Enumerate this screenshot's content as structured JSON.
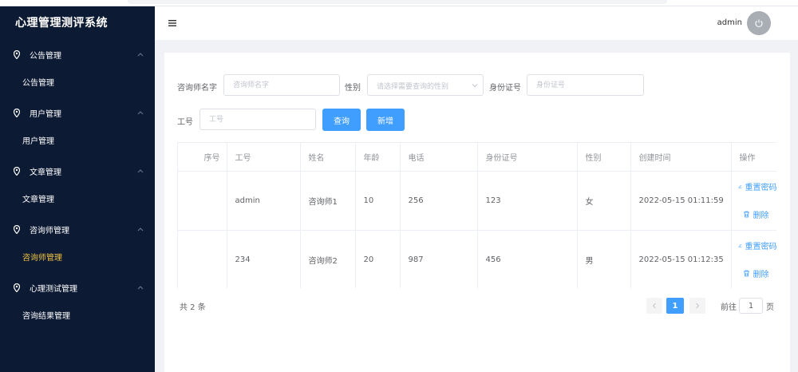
{
  "app": {
    "title": "心理管理测评系统"
  },
  "header": {
    "username": "admin"
  },
  "sidebar": {
    "groups": [
      {
        "label": "公告管理",
        "items": [
          {
            "label": "公告管理",
            "active": false
          }
        ]
      },
      {
        "label": "用户管理",
        "items": [
          {
            "label": "用户管理",
            "active": false
          }
        ]
      },
      {
        "label": "文章管理",
        "items": [
          {
            "label": "文章管理",
            "active": false
          }
        ]
      },
      {
        "label": "咨询师管理",
        "items": [
          {
            "label": "咨询师管理",
            "active": true
          }
        ]
      },
      {
        "label": "心理测试管理",
        "items": [
          {
            "label": "咨询结果管理",
            "active": false
          }
        ]
      }
    ]
  },
  "search": {
    "name_label": "咨询师名字",
    "name_placeholder": "咨询师名字",
    "gender_label": "性别",
    "gender_placeholder": "请选择需要查询的性别",
    "idcard_label": "身份证号",
    "idcard_placeholder": "身份证号",
    "jobno_label": "工号",
    "jobno_placeholder": "工号",
    "query_button": "查询",
    "add_button": "新增"
  },
  "table": {
    "headers": [
      "序号",
      "工号",
      "姓名",
      "年龄",
      "电话",
      "身份证号",
      "性别",
      "创建时间",
      "操作"
    ],
    "rows": [
      {
        "seq": "",
        "jobno": "admin",
        "name": "咨询师1",
        "age": "10",
        "phone": "256",
        "idcard": "123",
        "gender": "女",
        "created": "2022-05-15 01:11:59"
      },
      {
        "seq": "",
        "jobno": "234",
        "name": "咨询师2",
        "age": "20",
        "phone": "987",
        "idcard": "456",
        "gender": "男",
        "created": "2022-05-15 01:12:35"
      }
    ],
    "actions": {
      "reset": "重置密码",
      "delete": "删除"
    }
  },
  "pagination": {
    "total_text": "共 2 条",
    "current_page": "1",
    "goto_label": "前往",
    "goto_value": "1",
    "page_suffix": "页"
  },
  "colors": {
    "sidebar_bg": "#0c1a33",
    "accent": "#409eff",
    "active_menu": "#f0c341"
  }
}
